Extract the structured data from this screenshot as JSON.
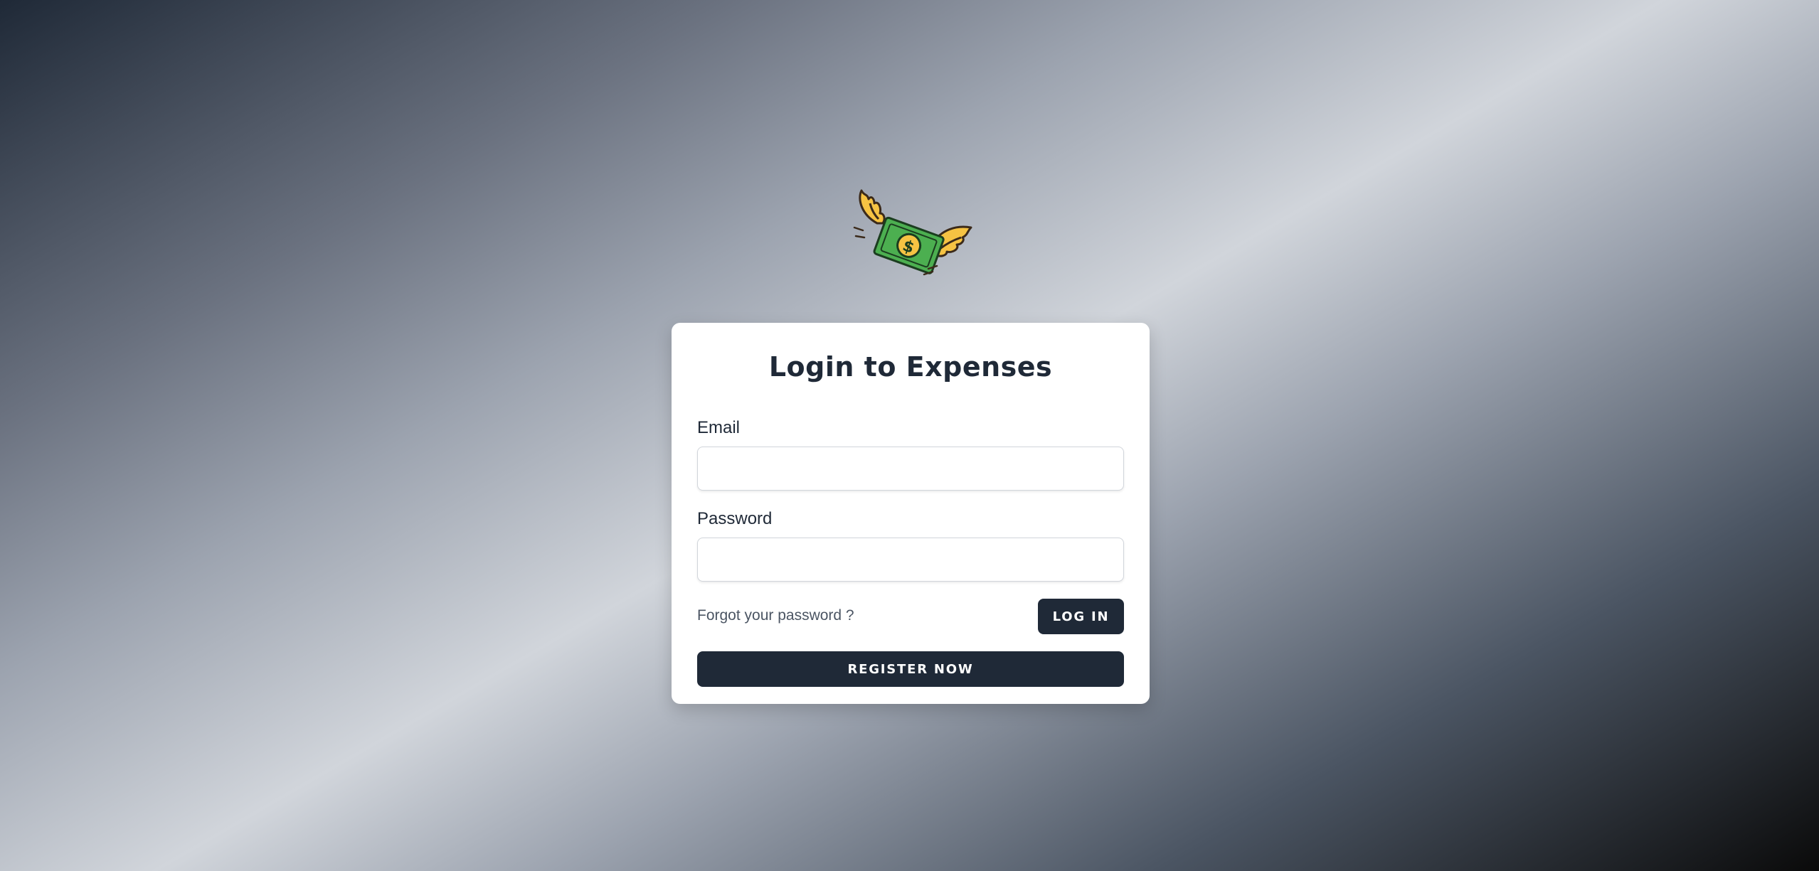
{
  "app": {
    "logo_icon": "flying-money-icon",
    "colors": {
      "primary": "#1f2937",
      "bill_green": "#4caf50",
      "wing_yellow": "#f6c343"
    }
  },
  "login_card": {
    "title": "Login to Expenses",
    "email_label": "Email",
    "email_value": "",
    "password_label": "Password",
    "password_value": "",
    "forgot_link": "Forgot your password ?",
    "login_button": "LOG IN",
    "register_button": "REGISTER NOW"
  }
}
